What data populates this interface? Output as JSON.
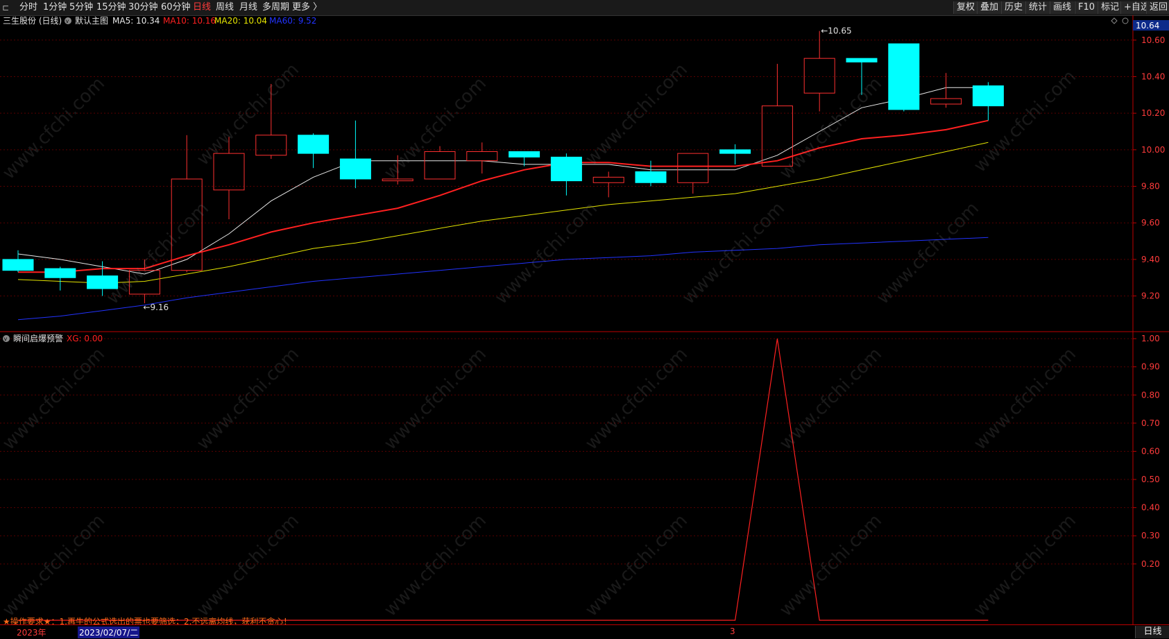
{
  "toolbar": {
    "menu_icon": "menu-collapse-icon",
    "left_items": [
      {
        "label": "分时",
        "active": false
      },
      {
        "label": "1分钟",
        "active": false
      },
      {
        "label": "5分钟",
        "active": false
      },
      {
        "label": "15分钟",
        "active": false
      },
      {
        "label": "30分钟",
        "active": false
      },
      {
        "label": "60分钟",
        "active": false
      },
      {
        "label": "日线",
        "active": true
      },
      {
        "label": "周线",
        "active": false
      },
      {
        "label": "月线",
        "active": false
      },
      {
        "label": "多周期",
        "active": false
      },
      {
        "label": "更多 〉",
        "active": false
      }
    ],
    "right_items": [
      "复权",
      "叠加",
      "历史",
      "统计",
      "画线",
      "F10",
      "标记",
      "+自选",
      "返回"
    ]
  },
  "main_chart": {
    "stock_name": "三生股份 (日线)",
    "template_label": "默认主图",
    "ma_legend": [
      {
        "label": "MA5: 10.34",
        "color": "#e8e8e8"
      },
      {
        "label": "MA10: 10.16",
        "color": "#ff2020"
      },
      {
        "label": "MA20: 10.04",
        "color": "#e6e600"
      },
      {
        "label": "MA60: 9.52",
        "color": "#2233ff"
      }
    ],
    "current_price_tag": "10.64",
    "high_marker": "10.65",
    "low_marker": "9.16",
    "panel_icons": [
      "diamond-icon",
      "circle-icon"
    ]
  },
  "indicator": {
    "name": "瞬间启爆预警",
    "value_label": "XG: 0.00"
  },
  "notice": "★操作要求★：1.再牛的公式选出的票也要筛选；2.不远离均线，获利不贪心！",
  "bottom": {
    "year_label": "2023年",
    "date_label": "2023/02/07/二",
    "month_label": "3",
    "period_tab": "日线"
  },
  "watermark": "www.cfchi.com",
  "chart_data": [
    {
      "type": "candlestick",
      "title": "三生股份 (日线)",
      "ylim": [
        9.02,
        10.66
      ],
      "yticks": [
        9.2,
        9.4,
        9.6,
        9.8,
        10.0,
        10.2,
        10.4,
        10.6
      ],
      "colors": {
        "up": "#ff3030",
        "down": "#00ffff"
      },
      "candles": [
        {
          "o": 9.4,
          "h": 9.45,
          "l": 9.33,
          "c": 9.34
        },
        {
          "o": 9.35,
          "h": 9.36,
          "l": 9.23,
          "c": 9.3
        },
        {
          "o": 9.31,
          "h": 9.39,
          "l": 9.2,
          "c": 9.24
        },
        {
          "o": 9.21,
          "h": 9.4,
          "l": 9.16,
          "c": 9.34
        },
        {
          "o": 9.34,
          "h": 10.08,
          "l": 9.33,
          "c": 9.84
        },
        {
          "o": 9.78,
          "h": 10.07,
          "l": 9.62,
          "c": 9.98
        },
        {
          "o": 9.97,
          "h": 10.36,
          "l": 9.95,
          "c": 10.08
        },
        {
          "o": 10.08,
          "h": 10.09,
          "l": 9.9,
          "c": 9.98
        },
        {
          "o": 9.95,
          "h": 10.16,
          "l": 9.79,
          "c": 9.84
        },
        {
          "o": 9.83,
          "h": 9.97,
          "l": 9.81,
          "c": 9.84
        },
        {
          "o": 9.84,
          "h": 10.02,
          "l": 9.84,
          "c": 9.99
        },
        {
          "o": 9.94,
          "h": 10.04,
          "l": 9.87,
          "c": 9.99
        },
        {
          "o": 9.99,
          "h": 9.99,
          "l": 9.91,
          "c": 9.96
        },
        {
          "o": 9.96,
          "h": 9.98,
          "l": 9.75,
          "c": 9.83
        },
        {
          "o": 9.82,
          "h": 9.88,
          "l": 9.74,
          "c": 9.85
        },
        {
          "o": 9.88,
          "h": 9.94,
          "l": 9.8,
          "c": 9.82
        },
        {
          "o": 9.82,
          "h": 9.98,
          "l": 9.76,
          "c": 9.98
        },
        {
          "o": 10.0,
          "h": 10.03,
          "l": 9.92,
          "c": 9.98
        },
        {
          "o": 9.91,
          "h": 10.47,
          "l": 9.91,
          "c": 10.24
        },
        {
          "o": 10.31,
          "h": 10.65,
          "l": 10.21,
          "c": 10.5
        },
        {
          "o": 10.5,
          "h": 10.5,
          "l": 10.3,
          "c": 10.48
        },
        {
          "o": 10.58,
          "h": 10.58,
          "l": 10.21,
          "c": 10.22
        },
        {
          "o": 10.25,
          "h": 10.42,
          "l": 10.23,
          "c": 10.28
        },
        {
          "o": 10.35,
          "h": 10.37,
          "l": 10.16,
          "c": 10.24
        }
      ],
      "series": [
        {
          "name": "MA5",
          "color": "#e8e8e8",
          "width": 1,
          "values": [
            9.43,
            9.4,
            9.36,
            9.32,
            9.4,
            9.54,
            9.72,
            9.85,
            9.94,
            9.94,
            9.94,
            9.94,
            9.92,
            9.92,
            9.92,
            9.89,
            9.89,
            9.89,
            9.97,
            10.1,
            10.23,
            10.28,
            10.34,
            10.34
          ]
        },
        {
          "name": "MA10",
          "color": "#ff2020",
          "width": 2,
          "values": [
            9.33,
            9.33,
            9.35,
            9.35,
            9.42,
            9.48,
            9.55,
            9.6,
            9.64,
            9.68,
            9.75,
            9.83,
            9.89,
            9.93,
            9.93,
            9.91,
            9.91,
            9.91,
            9.94,
            10.01,
            10.06,
            10.08,
            10.11,
            10.16
          ]
        },
        {
          "name": "MA20",
          "color": "#e6e600",
          "width": 1,
          "values": [
            9.29,
            9.28,
            9.27,
            9.28,
            9.32,
            9.36,
            9.41,
            9.46,
            9.49,
            9.53,
            9.57,
            9.61,
            9.64,
            9.67,
            9.7,
            9.72,
            9.74,
            9.76,
            9.8,
            9.84,
            9.89,
            9.94,
            9.99,
            10.04
          ]
        },
        {
          "name": "MA60",
          "color": "#2233ff",
          "width": 1,
          "values": [
            9.07,
            9.09,
            9.12,
            9.15,
            9.19,
            9.22,
            9.25,
            9.28,
            9.3,
            9.32,
            9.34,
            9.36,
            9.38,
            9.4,
            9.41,
            9.42,
            9.44,
            9.45,
            9.46,
            9.48,
            9.49,
            9.5,
            9.51,
            9.52
          ]
        }
      ]
    },
    {
      "type": "line",
      "title": "瞬间启爆预警",
      "ylim": [
        0.0,
        1.02
      ],
      "yticks": [
        0.2,
        0.3,
        0.4,
        0.5,
        0.6,
        0.7,
        0.8,
        0.9,
        1.0
      ],
      "series": [
        {
          "name": "XG",
          "color": "#ff2020",
          "values": [
            0,
            0,
            0,
            0,
            0,
            0,
            0,
            0,
            0,
            0,
            0,
            0,
            0,
            0,
            0,
            0,
            0,
            0,
            1,
            0,
            0,
            0,
            0,
            0
          ]
        }
      ]
    }
  ]
}
